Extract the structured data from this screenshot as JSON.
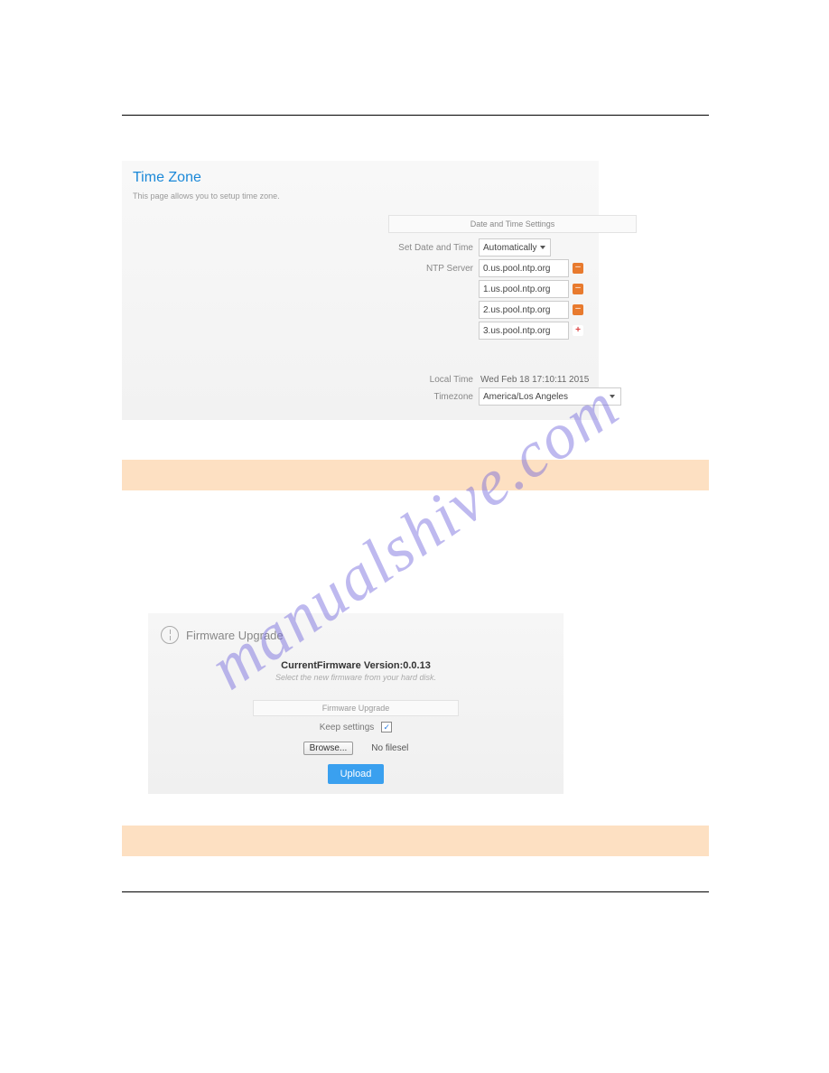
{
  "watermark": "manualshive.com",
  "timezone": {
    "title": "Time Zone",
    "description": "This page allows you to setup time zone.",
    "section_label": "Date and Time Settings",
    "set_date_label": "Set Date and Time",
    "set_date_value": "Automatically",
    "ntp_label": "NTP Server",
    "ntp_servers": [
      "0.us.pool.ntp.org",
      "1.us.pool.ntp.org",
      "2.us.pool.ntp.org",
      "3.us.pool.ntp.org"
    ],
    "local_time_label": "Local Time",
    "local_time_value": "Wed Feb 18 17:10:11 2015",
    "timezone_label": "Timezone",
    "timezone_value": "America/Los Angeles"
  },
  "note1": " ",
  "firmware": {
    "title": "Firmware Upgrade",
    "version_label": "CurrentFirmware Version:0.0.13",
    "subtext": "Select the new firmware from your hard disk.",
    "section_label": "Firmware Upgrade",
    "keep_label": "Keep settings",
    "keep_checked": "✓",
    "browse_label": "Browse...",
    "nofile": "No filesel",
    "upload_label": "Upload"
  },
  "note2": " "
}
